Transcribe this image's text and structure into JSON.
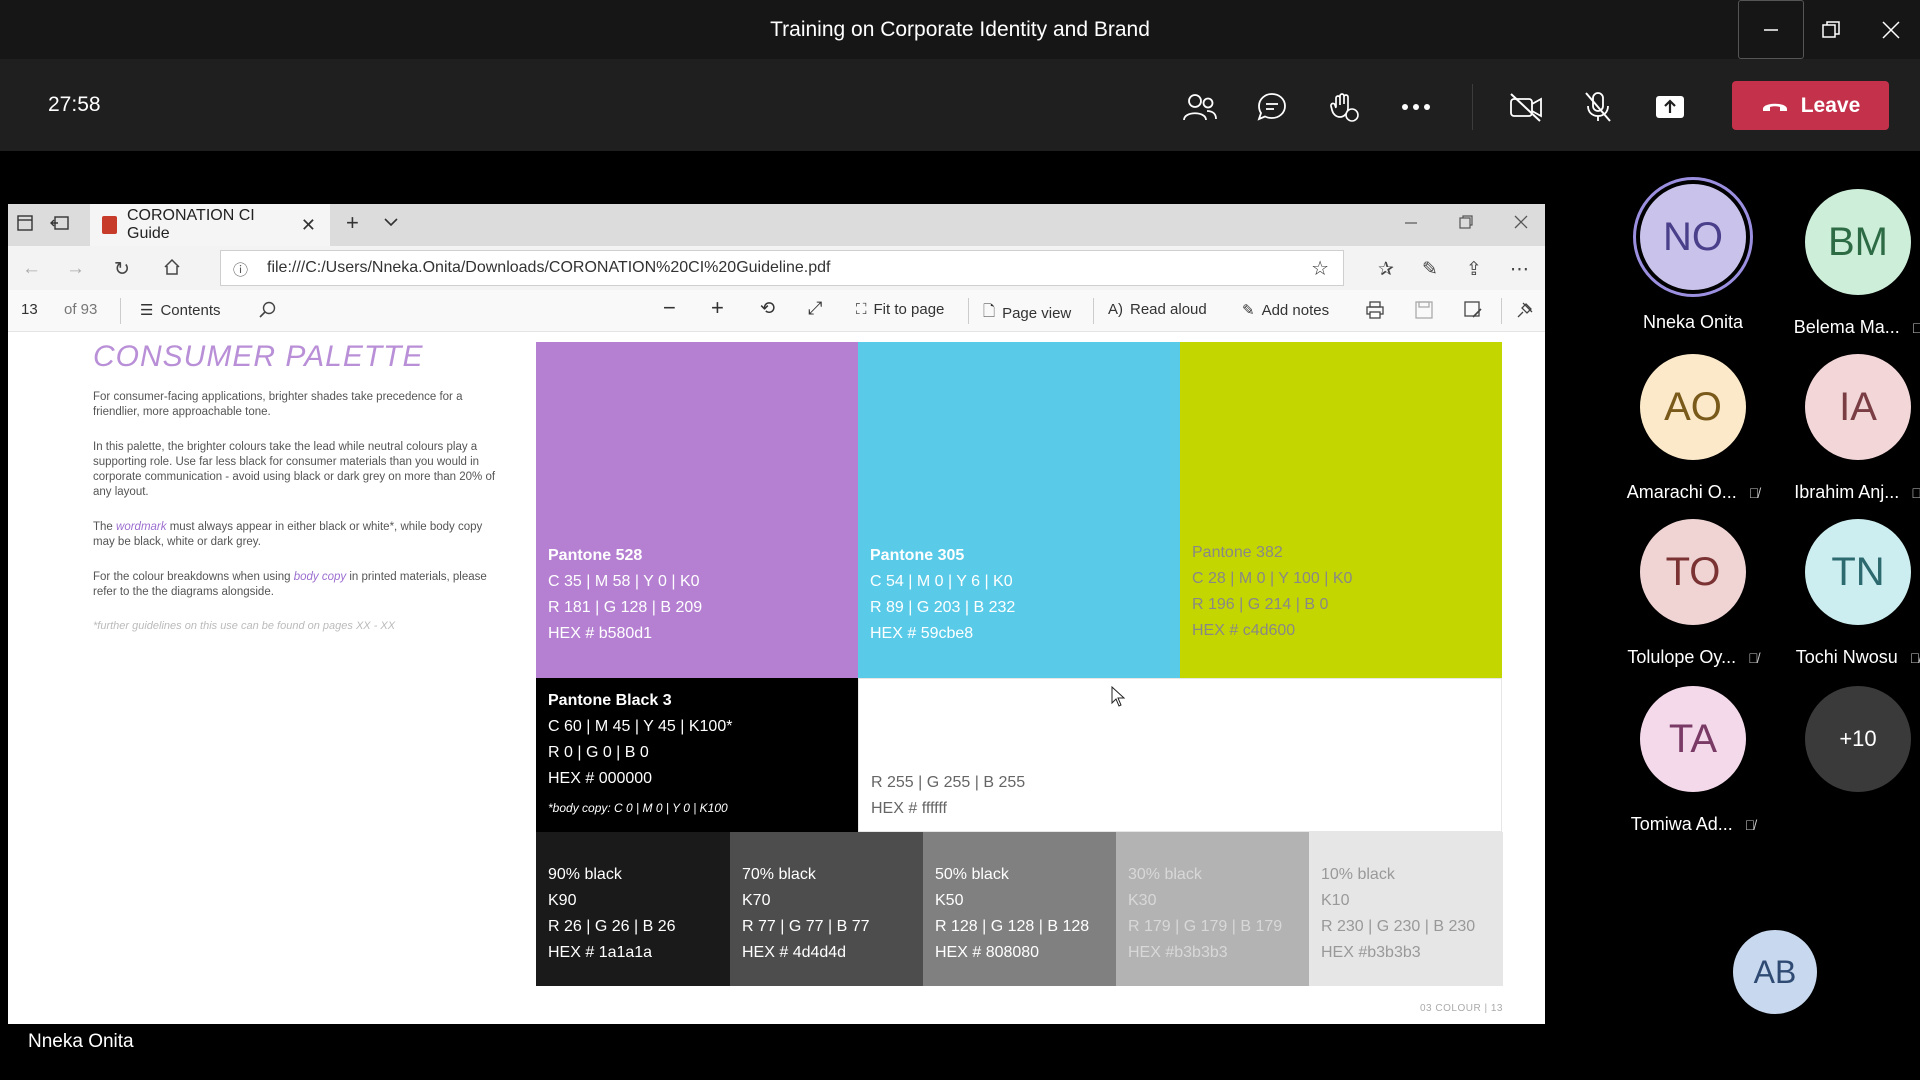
{
  "window": {
    "title": "Training on Corporate Identity and Brand"
  },
  "toolbar": {
    "timer": "27:58",
    "leave_label": "Leave"
  },
  "presenter": {
    "name": "Nneka Onita"
  },
  "browser": {
    "tab_title": "CORONATION CI Guide",
    "url": "file:///C:/Users/Nneka.Onita/Downloads/CORONATION%20CI%20Guideline.pdf"
  },
  "pdf_toolbar": {
    "page_number": "13",
    "page_total": "of 93",
    "contents_label": "Contents",
    "fit_label": "Fit to page",
    "page_view_label": "Page view",
    "read_aloud_label": "Read aloud",
    "add_notes_label": "Add notes"
  },
  "pdf_page": {
    "title": "CONSUMER PALETTE",
    "para1": "For consumer-facing applications, brighter shades take precedence for a friendlier, more approachable tone.",
    "para2": "In this palette, the brighter colours take the lead while neutral colours play a supporting role. Use far less black for consumer materials than you would in corporate communication - avoid using black or dark grey on more than 20% of any layout.",
    "para3_a": "The ",
    "para3_accent": "wordmark",
    "para3_b": " must always appear in either black or white*, while body copy may be black, white or dark grey.",
    "para4_a": "For the colour breakdowns when using ",
    "para4_accent": "body copy",
    "para4_b": " in printed materials, please refer to the the diagrams alongside.",
    "note": "*further guidelines on this use can be found on pages XX - XX",
    "footer": "03 COLOUR   |   13",
    "swatches": {
      "p528": {
        "name": "Pantone 528",
        "cmyk": "C 35 | M 58 | Y 0 | K0",
        "rgb": "R 181 | G 128 | B 209",
        "hex": "HEX # b580d1",
        "color": "#b580d1"
      },
      "p305": {
        "name": "Pantone 305",
        "cmyk": "C 54 | M 0 | Y 6 | K0",
        "rgb": "R 89 | G 203 | B 232",
        "hex": "HEX # 59cbe8",
        "color": "#59cbe8"
      },
      "p382": {
        "name": "Pantone 382",
        "cmyk": "C 28 | M 0 | Y 100 | K0",
        "rgb": "R 196 | G 214 | B 0",
        "hex": "HEX # c4d600",
        "color": "#c4d600"
      },
      "black": {
        "name": "Pantone Black 3",
        "cmyk": "C 60 | M 45 | Y 45 | K100*",
        "rgb": "R 0 | G 0 | B 0",
        "hex": "HEX # 000000",
        "note": "*body copy: C 0 | M 0 | Y 0 | K100",
        "color": "#000000"
      },
      "white": {
        "rgb": "R 255 | G 255 | B 255",
        "hex": "HEX # ffffff",
        "color": "#ffffff"
      },
      "g90": {
        "name": "90% black",
        "k": "K90",
        "rgb": "R 26 | G 26 | B 26",
        "hex": "HEX # 1a1a1a",
        "color": "#1a1a1a"
      },
      "g70": {
        "name": "70% black",
        "k": "K70",
        "rgb": "R 77 | G 77 | B 77",
        "hex": "HEX # 4d4d4d",
        "color": "#4d4d4d"
      },
      "g50": {
        "name": "50% black",
        "k": "K50",
        "rgb": "R 128 | G 128 | B 128",
        "hex": "HEX # 808080",
        "color": "#808080"
      },
      "g30": {
        "name": "30% black",
        "k": "K30",
        "rgb": "R 179 | G 179 | B 179",
        "hex": "HEX #b3b3b3",
        "color": "#b3b3b3"
      },
      "g10": {
        "name": "10% black",
        "k": "K10",
        "rgb": "R 230 | G 230 | B 230",
        "hex": "HEX #b3b3b3",
        "color": "#e6e6e6"
      }
    }
  },
  "participants": [
    {
      "initials": "NO",
      "name": "Nneka Onita",
      "muted": false,
      "bg": "#c9c3ec",
      "fg": "#4a3f8a"
    },
    {
      "initials": "BM",
      "name": "Belema Ma...",
      "muted": true,
      "bg": "#cdeed9",
      "fg": "#2d6b45"
    },
    {
      "initials": "AO",
      "name": "Amarachi O...",
      "muted": true,
      "bg": "#fbe9c9",
      "fg": "#7a5a1a"
    },
    {
      "initials": "IA",
      "name": "Ibrahim Anj...",
      "muted": true,
      "bg": "#f2d6d8",
      "fg": "#7a3d44"
    },
    {
      "initials": "TO",
      "name": "Tolulope Oy...",
      "muted": true,
      "bg": "#f0d4d4",
      "fg": "#7a3232"
    },
    {
      "initials": "TN",
      "name": "Tochi Nwosu",
      "muted": true,
      "bg": "#cdeef0",
      "fg": "#2c6a70"
    },
    {
      "initials": "TA",
      "name": "Tomiwa Ad...",
      "muted": true,
      "bg": "#f3d9ea",
      "fg": "#7a3a66"
    },
    {
      "initials": "AB",
      "name": "",
      "muted": false,
      "bg": "#c8d8ee",
      "fg": "#2f4b73"
    }
  ],
  "overflow_count": "+10",
  "colors": {
    "leave": "#c4314b",
    "toolbar": "#1f1f1f",
    "titlebar": "#161616"
  },
  "icons": [
    "people-icon",
    "chat-icon",
    "raise-hand-icon",
    "more-icon",
    "camera-off-icon",
    "mic-off-icon",
    "share-icon",
    "phone-icon"
  ]
}
